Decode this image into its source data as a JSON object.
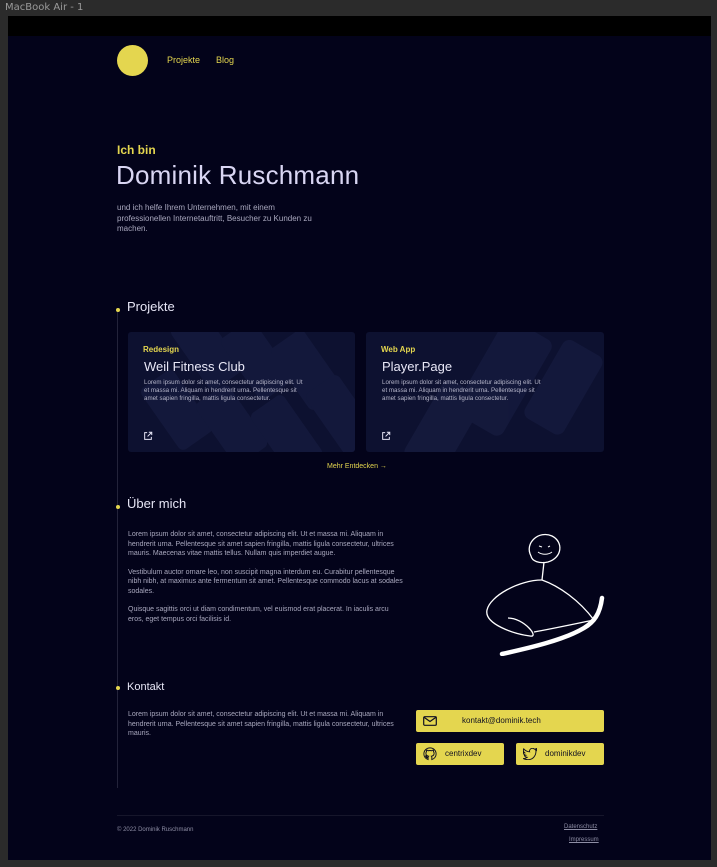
{
  "window": {
    "title": "MacBook Air - 1"
  },
  "nav": {
    "projects_label": "Projekte",
    "blog_label": "Blog"
  },
  "hero": {
    "kicker": "Ich bin",
    "name": "Dominik Ruschmann",
    "subtitle": "und ich helfe Ihrem Unternehmen, mit einem professionellen Internetauftritt, Besucher zu Kunden zu machen."
  },
  "projects": {
    "title": "Projekte",
    "cards": [
      {
        "tag": "Redesign",
        "title": "Weil Fitness Club",
        "description": "Lorem ipsum dolor sit amet, consectetur adipiscing elit. Ut et massa mi. Aliquam in hendrerit urna. Pellentesque sit amet sapien fringilla, mattis ligula consectetur.",
        "icon": "external-link-icon"
      },
      {
        "tag": "Web App",
        "title": "Player.Page",
        "description": "Lorem ipsum dolor sit amet, consectetur adipiscing elit. Ut et massa mi. Aliquam in hendrerit urna. Pellentesque sit amet sapien fringilla, mattis ligula consectetur.",
        "icon": "external-link-icon"
      }
    ],
    "more_label": "Mehr Entdecken →"
  },
  "about": {
    "title": "Über mich",
    "paragraphs": [
      "Lorem ipsum dolor sit amet, consectetur adipiscing elit. Ut et massa mi. Aliquam in hendrerit urna. Pellentesque sit amet sapien fringilla, mattis ligula consectetur, ultrices mauris. Maecenas vitae mattis tellus. Nullam quis imperdiet augue.",
      "Vestibulum auctor ornare leo, non suscipit magna interdum eu. Curabitur pellentesque nibh nibh, at maximus ante fermentum sit amet. Pellentesque commodo lacus at sodales sodales.",
      "Quisque sagittis orci ut diam condimentum, vel euismod erat placerat. In iaculis arcu eros, eget tempus orci facilisis id."
    ]
  },
  "contact": {
    "title": "Kontakt",
    "text": "Lorem ipsum dolor sit amet, consectetur adipiscing elit. Ut et massa mi. Aliquam in hendrerit urna. Pellentesque sit amet sapien fringilla, mattis ligula consectetur, ultrices mauris.",
    "email_label": "kontakt@dominik.tech",
    "github_label": "centrixdev",
    "twitter_label": "dominikdev"
  },
  "footer": {
    "copyright": "© 2022 Dominik Ruschmann",
    "privacy_label": "Datenschutz",
    "imprint_label": "Impressum"
  },
  "colors": {
    "accent": "#e4d64f",
    "background": "#03031a",
    "card": "#0d1130",
    "text_primary": "#d9d6f3",
    "text_muted": "#a9a8be"
  }
}
